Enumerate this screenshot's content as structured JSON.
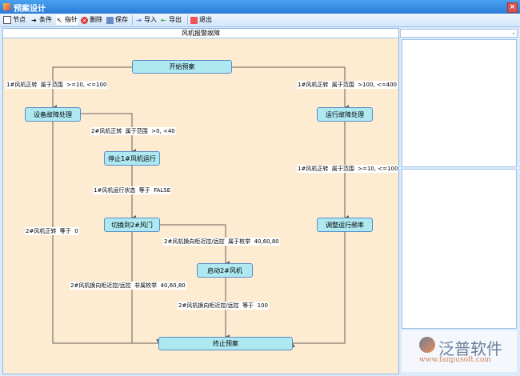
{
  "window": {
    "title": "预案设计",
    "close": "×"
  },
  "toolbar": {
    "node": "节点",
    "condition": "条件",
    "pointer": "指针",
    "delete": "删除",
    "save": "保存",
    "import": "导入",
    "export": "导出",
    "exit": "退出"
  },
  "canvas": {
    "header": "风机报警故障"
  },
  "nodes": {
    "start": "开始预案",
    "equip": "设备故障处理",
    "run": "运行故障处理",
    "stop1": "停止1#风机运行",
    "switch2": "切换到2#风门",
    "adjust": "调整运行频率",
    "start2": "启动2#风机",
    "end": "终止预案"
  },
  "edges": {
    "e1": "1#风机正转  属于范围  >=10, <=100",
    "e2": "1#风机正转  属于范围  >100, <=400",
    "e3": "2#风机正转  属于范围  >0, <40",
    "e4": "1#风机运行状态  等于  FALSE",
    "e5": "1#风机正转  属于范围  >=10, <=100",
    "e6": "2#风机换向柜近控/远控  属于枚举  40,60,80",
    "e7": "2#风机换向柜近控/远控  非属枚举  40,60,80",
    "e8": "2#风机正转  等于  0",
    "e9": "2#风机换向柜近控/远控  等于  100"
  },
  "logo": {
    "name": "泛普软件",
    "url": "www.fanpusoft.com"
  }
}
